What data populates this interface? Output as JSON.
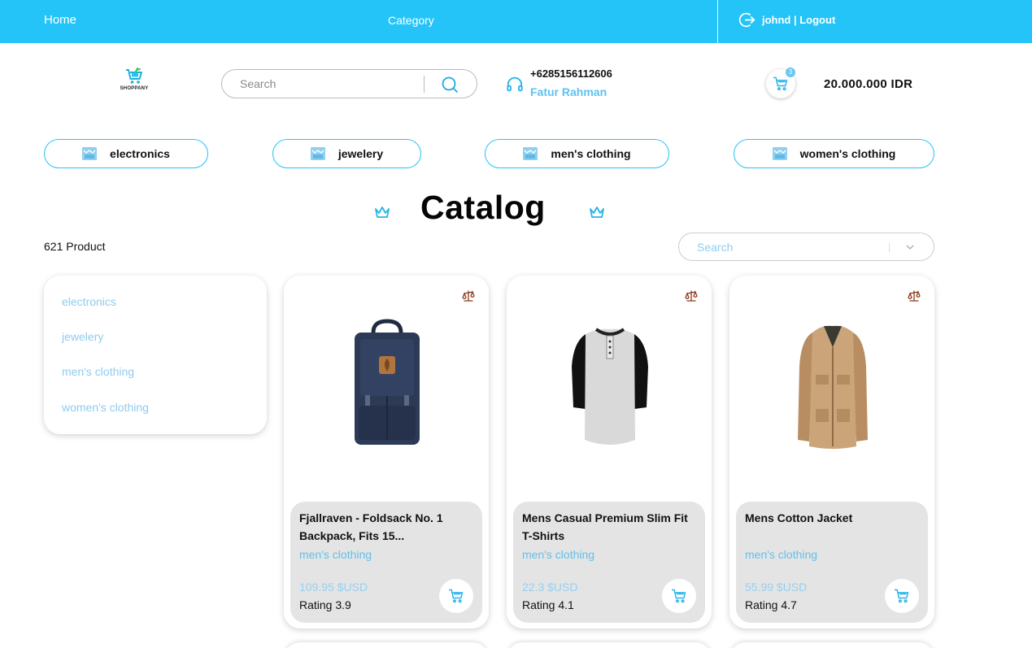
{
  "topbar": {
    "home": "Home",
    "category": "Category",
    "user": "johnd | Logout",
    "logout_icon": "logout-icon"
  },
  "header": {
    "logo_text": "SHOPPANY",
    "search_placeholder": "Search",
    "phone": "+6285156112606",
    "contact_name": "Fatur Rahman",
    "cart_count": "3",
    "cart_total": "20.000.000 IDR"
  },
  "categories": [
    "electronics",
    "jewelery",
    "men's clothing",
    "women's clothing"
  ],
  "catalog": {
    "title": "Catalog",
    "product_count": "621 Product",
    "sort_placeholder": "Search"
  },
  "sidebar": {
    "items": [
      "electronics",
      "jewelery",
      "men's clothing",
      "women's clothing"
    ]
  },
  "products": [
    {
      "title": "Fjallraven - Foldsack No. 1 Backpack, Fits 15...",
      "category": "men's clothing",
      "price": "109.95 $USD",
      "rating": "Rating 3.9"
    },
    {
      "title": "Mens Casual Premium Slim Fit T-Shirts",
      "category": "men's clothing",
      "price": "22.3 $USD",
      "rating": "Rating 4.1"
    },
    {
      "title": "Mens Cotton Jacket",
      "category": "men's clothing",
      "price": "55.99 $USD",
      "rating": "Rating 4.7"
    }
  ],
  "colors": {
    "accent": "#25c4f8",
    "link": "#5fc1ee",
    "card_info_bg": "#e4e4e4"
  }
}
